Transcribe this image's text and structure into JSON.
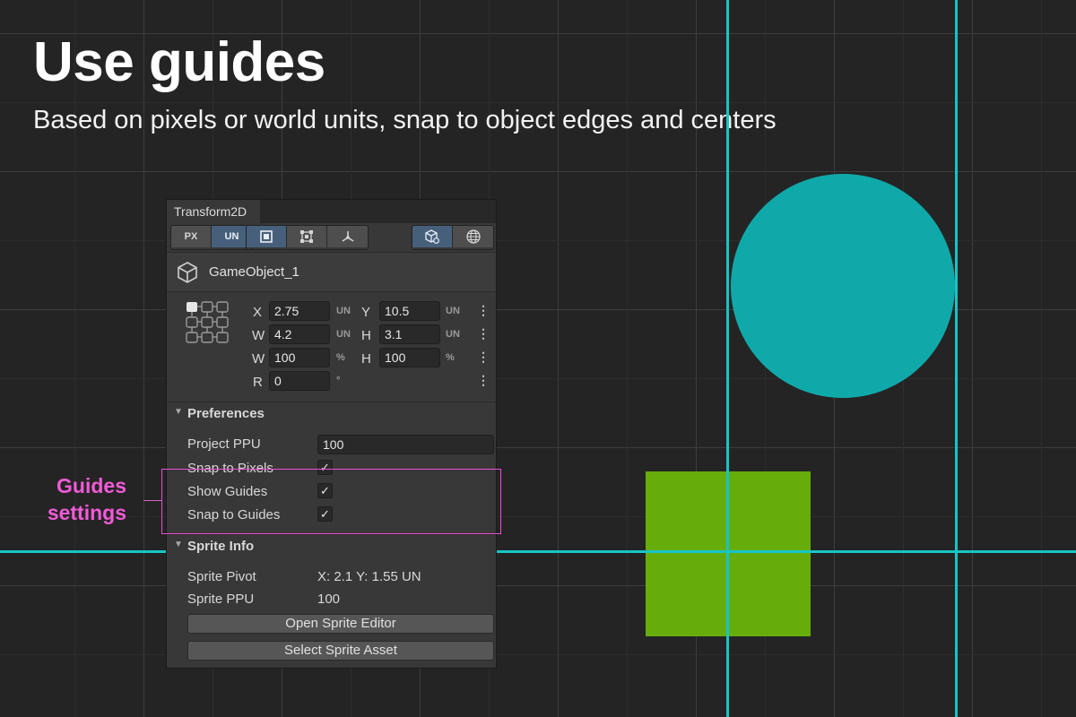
{
  "headline": "Use guides",
  "subline": "Based on pixels or world units, snap to object edges and centers",
  "colors": {
    "background": "#242424",
    "guide": "#17c4c6",
    "circle": "#10a9aa",
    "square": "#66ad0c",
    "highlight": "#e94fd1",
    "callout": "#f25ad8"
  },
  "callout": {
    "line1": "Guides",
    "line2": "settings"
  },
  "panel": {
    "tab_label": "Transform2D",
    "toolbar": {
      "px_label": "PX",
      "un_label": "UN",
      "icons": [
        "rect-tool-icon",
        "bounds-tool-icon",
        "pivot-tool-icon",
        "local-space-icon",
        "world-space-icon"
      ]
    },
    "object_name": "GameObject_1",
    "fields": {
      "x_label": "X",
      "x_value": "2.75",
      "x_unit": "UN",
      "y_label": "Y",
      "y_value": "10.5",
      "y_unit": "UN",
      "w_label": "W",
      "w_value": "4.2",
      "w_unit": "UN",
      "h_label": "H",
      "h_value": "3.1",
      "h_unit": "UN",
      "wp_label": "W",
      "wp_value": "100",
      "wp_unit": "%",
      "hp_label": "H",
      "hp_value": "100",
      "hp_unit": "%",
      "r_label": "R",
      "r_value": "0",
      "r_unit": "°",
      "kebab": "⋮"
    },
    "preferences": {
      "title": "Preferences",
      "project_ppu_label": "Project PPU",
      "project_ppu_value": "100",
      "snap_pixels_label": "Snap to Pixels",
      "show_guides_label": "Show Guides",
      "snap_guides_label": "Snap to Guides",
      "check_mark": "✓"
    },
    "sprite_info": {
      "title": "Sprite Info",
      "pivot_label": "Sprite Pivot",
      "pivot_value": "X: 2.1  Y: 1.55 UN",
      "ppu_label": "Sprite PPU",
      "ppu_value": "100",
      "open_editor_label": "Open Sprite Editor",
      "select_asset_label": "Select Sprite Asset"
    }
  }
}
